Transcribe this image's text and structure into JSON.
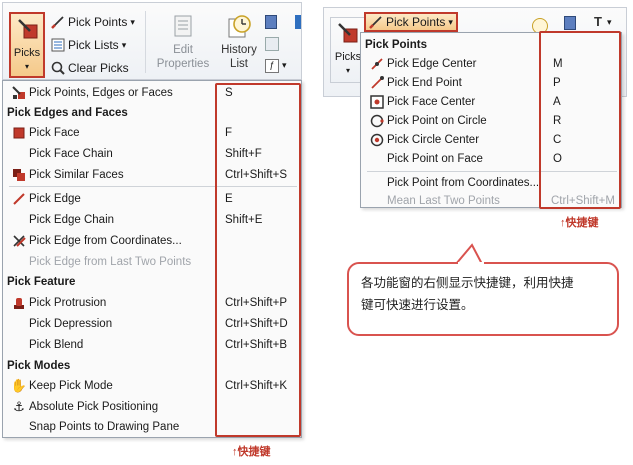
{
  "left": {
    "ribbon": {
      "picks_label": "Picks",
      "picks_arrow": "▾",
      "pick_points": "Pick Points",
      "pick_lists": "Pick Lists",
      "clear_picks": "Clear Picks",
      "edit_properties_1": "Edit",
      "edit_properties_2": "Properties",
      "history_list_1": "History",
      "history_list_2": "List",
      "dropdown_arrow": "▾"
    },
    "menu": {
      "item_pick_points_edges": {
        "label": "Pick Points, Edges or Faces",
        "shortcut": "S"
      },
      "hdr_edges_faces": "Pick Edges and Faces",
      "item_pick_face": {
        "label": "Pick Face",
        "shortcut": "F"
      },
      "item_pick_face_chain": {
        "label": "Pick Face Chain",
        "shortcut": "Shift+F"
      },
      "item_pick_similar_faces": {
        "label": "Pick Similar Faces",
        "shortcut": "Ctrl+Shift+S"
      },
      "item_pick_edge": {
        "label": "Pick Edge",
        "shortcut": "E"
      },
      "item_pick_edge_chain": {
        "label": "Pick Edge Chain",
        "shortcut": "Shift+E"
      },
      "item_pick_edge_coords": {
        "label": "Pick Edge from Coordinates...",
        "shortcut": ""
      },
      "item_pick_edge_last_two": {
        "label": "Pick Edge from Last Two Points",
        "shortcut": ""
      },
      "hdr_feature": "Pick Feature",
      "item_pick_protrusion": {
        "label": "Pick Protrusion",
        "shortcut": "Ctrl+Shift+P"
      },
      "item_pick_depression": {
        "label": "Pick Depression",
        "shortcut": "Ctrl+Shift+D"
      },
      "item_pick_blend": {
        "label": "Pick Blend",
        "shortcut": "Ctrl+Shift+B"
      },
      "hdr_modes": "Pick Modes",
      "item_keep_pick_mode": {
        "label": "Keep Pick Mode",
        "shortcut": "Ctrl+Shift+K"
      },
      "item_absolute_pick": {
        "label": "Absolute Pick Positioning",
        "shortcut": ""
      },
      "item_snap_points": {
        "label": "Snap Points to Drawing Pane",
        "shortcut": ""
      }
    },
    "shortcut_note": "↑快捷键"
  },
  "right": {
    "ribbon": {
      "picks_label": "Picks",
      "picks_arrow": "▾",
      "pick_points": "Pick Points",
      "dropdown_arrow": "▾"
    },
    "menu": {
      "hdr_pick_points": "Pick Points",
      "item_edge_center": {
        "label": "Pick Edge Center",
        "shortcut": "M"
      },
      "item_end_point": {
        "label": "Pick End Point",
        "shortcut": "P"
      },
      "item_face_center": {
        "label": "Pick Face Center",
        "shortcut": "A"
      },
      "item_point_on_circle": {
        "label": "Pick Point on Circle",
        "shortcut": "R"
      },
      "item_circle_center": {
        "label": "Pick Circle Center",
        "shortcut": "C"
      },
      "item_point_on_face": {
        "label": "Pick Point on Face",
        "shortcut": "O"
      },
      "item_point_from_coords": {
        "label": "Pick Point from Coordinates...",
        "shortcut": ""
      },
      "item_mean_last_two": {
        "label": "Mean Last Two Points",
        "shortcut": "Ctrl+Shift+M"
      }
    },
    "shortcut_note": "↑快捷键"
  },
  "callout": {
    "line1": "各功能窗的右侧显示快捷键，利用快捷",
    "line2": "键可快速进行设置。"
  },
  "colors": {
    "highlight": "#c0392b",
    "menu_bg": "#fafafa",
    "ribbon_bg": "#eef1f5"
  }
}
